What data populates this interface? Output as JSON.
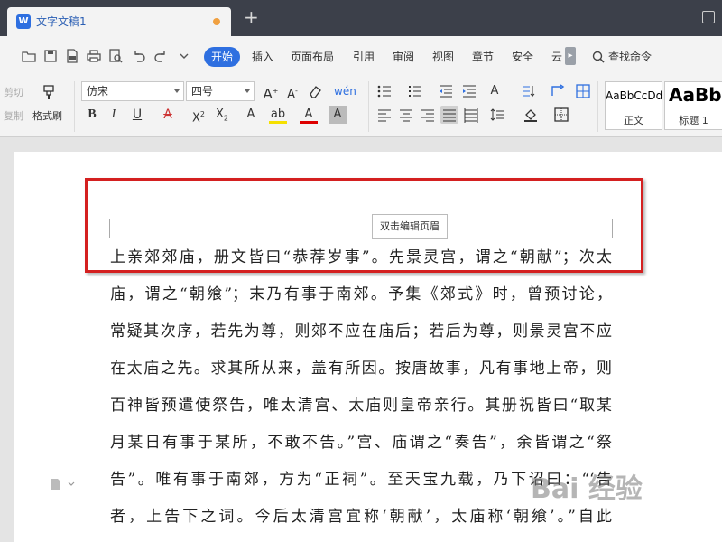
{
  "titlebar": {
    "doc_icon_glyph": "W",
    "doc_title": "文字文稿1",
    "new_tab_glyph": "+"
  },
  "menu": {
    "items": [
      "开始",
      "插入",
      "页面布局",
      "引用",
      "审阅",
      "视图",
      "章节",
      "安全",
      "云"
    ],
    "active_index": 0,
    "search_command": "查找命令",
    "accent_color": "#2e6fe0"
  },
  "ribbon": {
    "cut_label": "剪切",
    "copy_label": "复制",
    "format_painter_label": "格式刷",
    "font_name": "仿宋",
    "font_size": "四号",
    "style_normal_sample": "AaBbCcDd",
    "style_normal_name": "正文",
    "style_heading_sample": "AaBb",
    "style_heading_name": "标题 1"
  },
  "document": {
    "header_hint_button": "双击编辑页眉",
    "paragraph_lines": [
      "上亲郊郊庙，册文皆曰“恭荐岁事”。先景灵宫，谓之“朝献”；次太",
      "庙，谓之“朝飨”；末乃有事于南郊。予集《郊式》时，曾预讨论，",
      "常疑其次序，若先为尊，则郊不应在庙后；若后为尊，则景灵宫不应",
      "在太庙之先。求其所从来，盖有所因。按唐故事，凡有事地上帝，则",
      "百神皆预遣使祭告，唯太清宫、太庙则皇帝亲行。其册祝皆曰“取某",
      "月某日有事于某所，不敢不告。”宫、庙谓之“奏告”，余皆谓之“祭",
      "告”。唯有事于南郊，方为“正祠”。至天宝九载，乃下诏曰：“‘告",
      "者，上告下之词。今后太清宫宜称‘朝献’，太庙称‘朝飨’。”自此"
    ],
    "highlight_color": "#d42020"
  },
  "watermark": {
    "text": "Bai 经验"
  }
}
